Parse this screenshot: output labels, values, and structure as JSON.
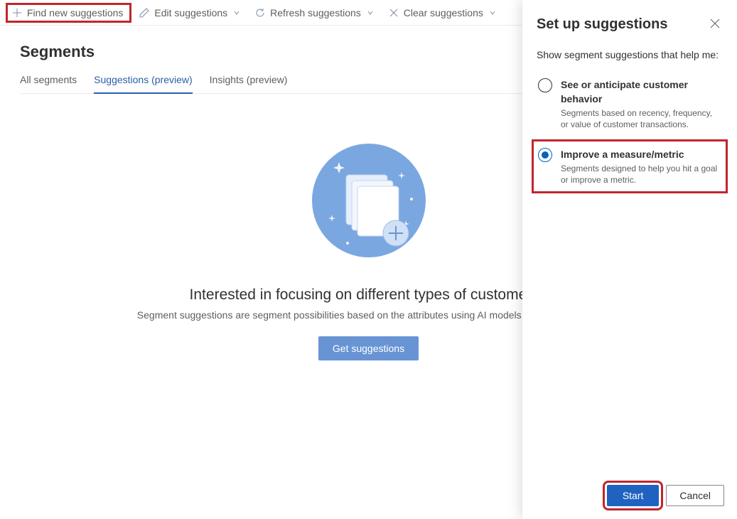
{
  "toolbar": {
    "find_new": "Find new suggestions",
    "edit": "Edit suggestions",
    "refresh": "Refresh suggestions",
    "clear": "Clear suggestions"
  },
  "page_title": "Segments",
  "tabs": [
    {
      "label": "All segments",
      "active": false
    },
    {
      "label": "Suggestions (preview)",
      "active": true
    },
    {
      "label": "Insights (preview)",
      "active": false
    }
  ],
  "empty": {
    "title": "Interested in focusing on different types of customers?",
    "desc": "Segment suggestions are segment possibilities based on the attributes using AI models or based on activ",
    "button": "Get suggestions"
  },
  "panel": {
    "title": "Set up suggestions",
    "intro": "Show segment suggestions that help me:",
    "options": [
      {
        "title": "See or anticipate customer behavior",
        "desc": "Segments based on recency, frequency, or value of customer transactions.",
        "selected": false
      },
      {
        "title": "Improve a measure/metric",
        "desc": "Segments designed to help you hit a goal or improve a metric.",
        "selected": true
      }
    ],
    "start": "Start",
    "cancel": "Cancel"
  }
}
